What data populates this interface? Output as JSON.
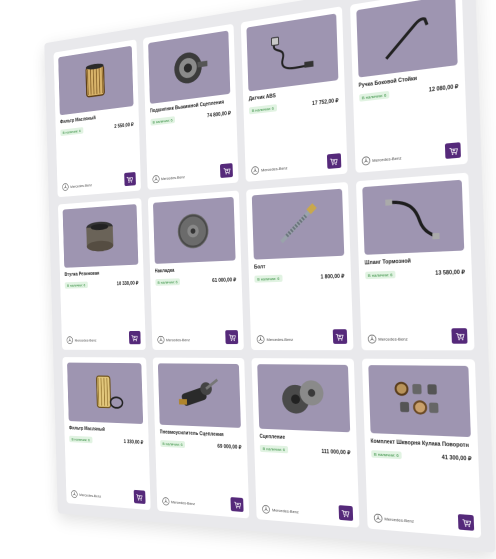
{
  "brand_name": "Mercedes-Benz",
  "in_stock_label": "В наличии: 6",
  "colors": {
    "image_bg": "#9e95b1",
    "cart_button": "#55297a",
    "stock_green": "#2e8a3a"
  },
  "products": [
    {
      "title": "Фильтр Масляный",
      "price": "2 550,00 ₽",
      "old_price": "",
      "part_no": "",
      "stock": "В наличии: 6",
      "icon": "oil-filter"
    },
    {
      "title": "Подшипник Выжимной Сцепления",
      "price": "74 800,00 ₽",
      "old_price": "",
      "part_no": "",
      "stock": "В наличии: 6",
      "icon": "clutch-bearing"
    },
    {
      "title": "Датчик ABS",
      "price": "17 752,00 ₽",
      "old_price": "",
      "part_no": "",
      "stock": "В наличии: 6",
      "icon": "abs-sensor"
    },
    {
      "title": "Ручка Боковой Стойки",
      "price": "12 080,00 ₽",
      "old_price": "",
      "part_no": "",
      "stock": "В наличии: 6",
      "icon": "handle-rod"
    },
    {
      "title": "Втулка Резиновая",
      "price": "10 330,00 ₽",
      "old_price": "",
      "part_no": "",
      "stock": "В наличии: 6",
      "icon": "bushing"
    },
    {
      "title": "Накладка",
      "price": "61 000,00 ₽",
      "old_price": "",
      "part_no": "",
      "stock": "В наличии: 6",
      "icon": "brake-disc"
    },
    {
      "title": "Болт",
      "price": "1 800,00 ₽",
      "old_price": "",
      "part_no": "",
      "stock": "В наличии: 6",
      "icon": "bolt"
    },
    {
      "title": "Шланг Тормозной",
      "price": "13 580,00 ₽",
      "old_price": "",
      "part_no": "",
      "stock": "В наличии: 6",
      "icon": "brake-hose"
    },
    {
      "title": "Фильтр Масляный",
      "price": "1 330,00 ₽",
      "old_price": "",
      "part_no": "",
      "stock": "В наличии: 6",
      "icon": "oil-filter-2"
    },
    {
      "title": "Пневмоусилитель Сцепления",
      "price": "69 000,00 ₽",
      "old_price": "",
      "part_no": "",
      "stock": "В наличии: 6",
      "icon": "clutch-booster"
    },
    {
      "title": "Сцепление",
      "price": "111 000,00 ₽",
      "old_price": "",
      "part_no": "",
      "stock": "В наличии: 6",
      "icon": "clutch-kit"
    },
    {
      "title": "Комплект Шкворня Кулака Поворотн",
      "price": "41 300,00 ₽",
      "old_price": "",
      "part_no": "",
      "stock": "В наличии: 6",
      "icon": "kingpin-kit"
    }
  ]
}
